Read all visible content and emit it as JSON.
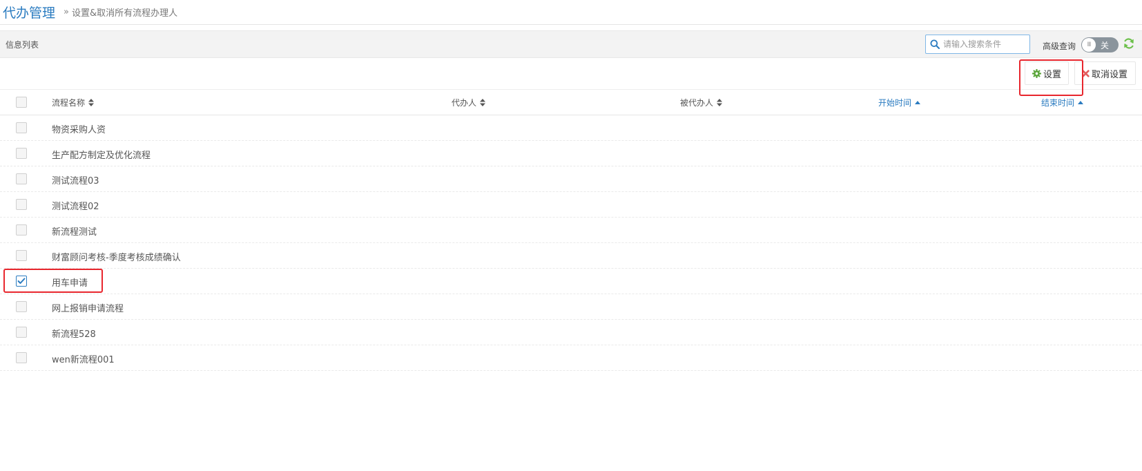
{
  "header": {
    "title": "代办管理",
    "separator": "»",
    "subtitle": "设置&取消所有流程办理人"
  },
  "toolbar": {
    "label": "信息列表",
    "search": {
      "placeholder": "请输入搜索条件",
      "value": "",
      "icon": "search-icon"
    },
    "advanced_label": "高级查询",
    "toggle": {
      "knob": "III",
      "state_label": "关",
      "on": false
    },
    "refresh_icon": "refresh-icon"
  },
  "actions": {
    "set_label": "设置",
    "set_icon": "gear-icon",
    "cancel_label": "取消设置",
    "cancel_icon": "close-icon"
  },
  "table": {
    "columns": [
      {
        "label": "流程名称",
        "sort": "both",
        "active": false
      },
      {
        "label": "代办人",
        "sort": "both",
        "active": false
      },
      {
        "label": "被代办人",
        "sort": "both",
        "active": false
      },
      {
        "label": "开始时间",
        "sort": "asc",
        "active": true
      },
      {
        "label": "结束时间",
        "sort": "asc",
        "active": true
      }
    ],
    "rows": [
      {
        "name": "物资采购人资",
        "checked": false
      },
      {
        "name": "生产配方制定及优化流程",
        "checked": false
      },
      {
        "name": "测试流程03",
        "checked": false
      },
      {
        "name": "测试流程02",
        "checked": false
      },
      {
        "name": "新流程测试",
        "checked": false
      },
      {
        "name": "财富顾问考核-季度考核成绩确认",
        "checked": false
      },
      {
        "name": "用车申请",
        "checked": true
      },
      {
        "name": "网上报销申请流程",
        "checked": false
      },
      {
        "name": "新流程528",
        "checked": false
      },
      {
        "name": "wen新流程001",
        "checked": false
      }
    ]
  },
  "colors": {
    "accent": "#2a7bc0",
    "highlight": "#e8262d",
    "gear": "#5aa53a",
    "close": "#e25c5c",
    "refresh": "#6cc04a",
    "toggle_bg": "#8a949c"
  }
}
